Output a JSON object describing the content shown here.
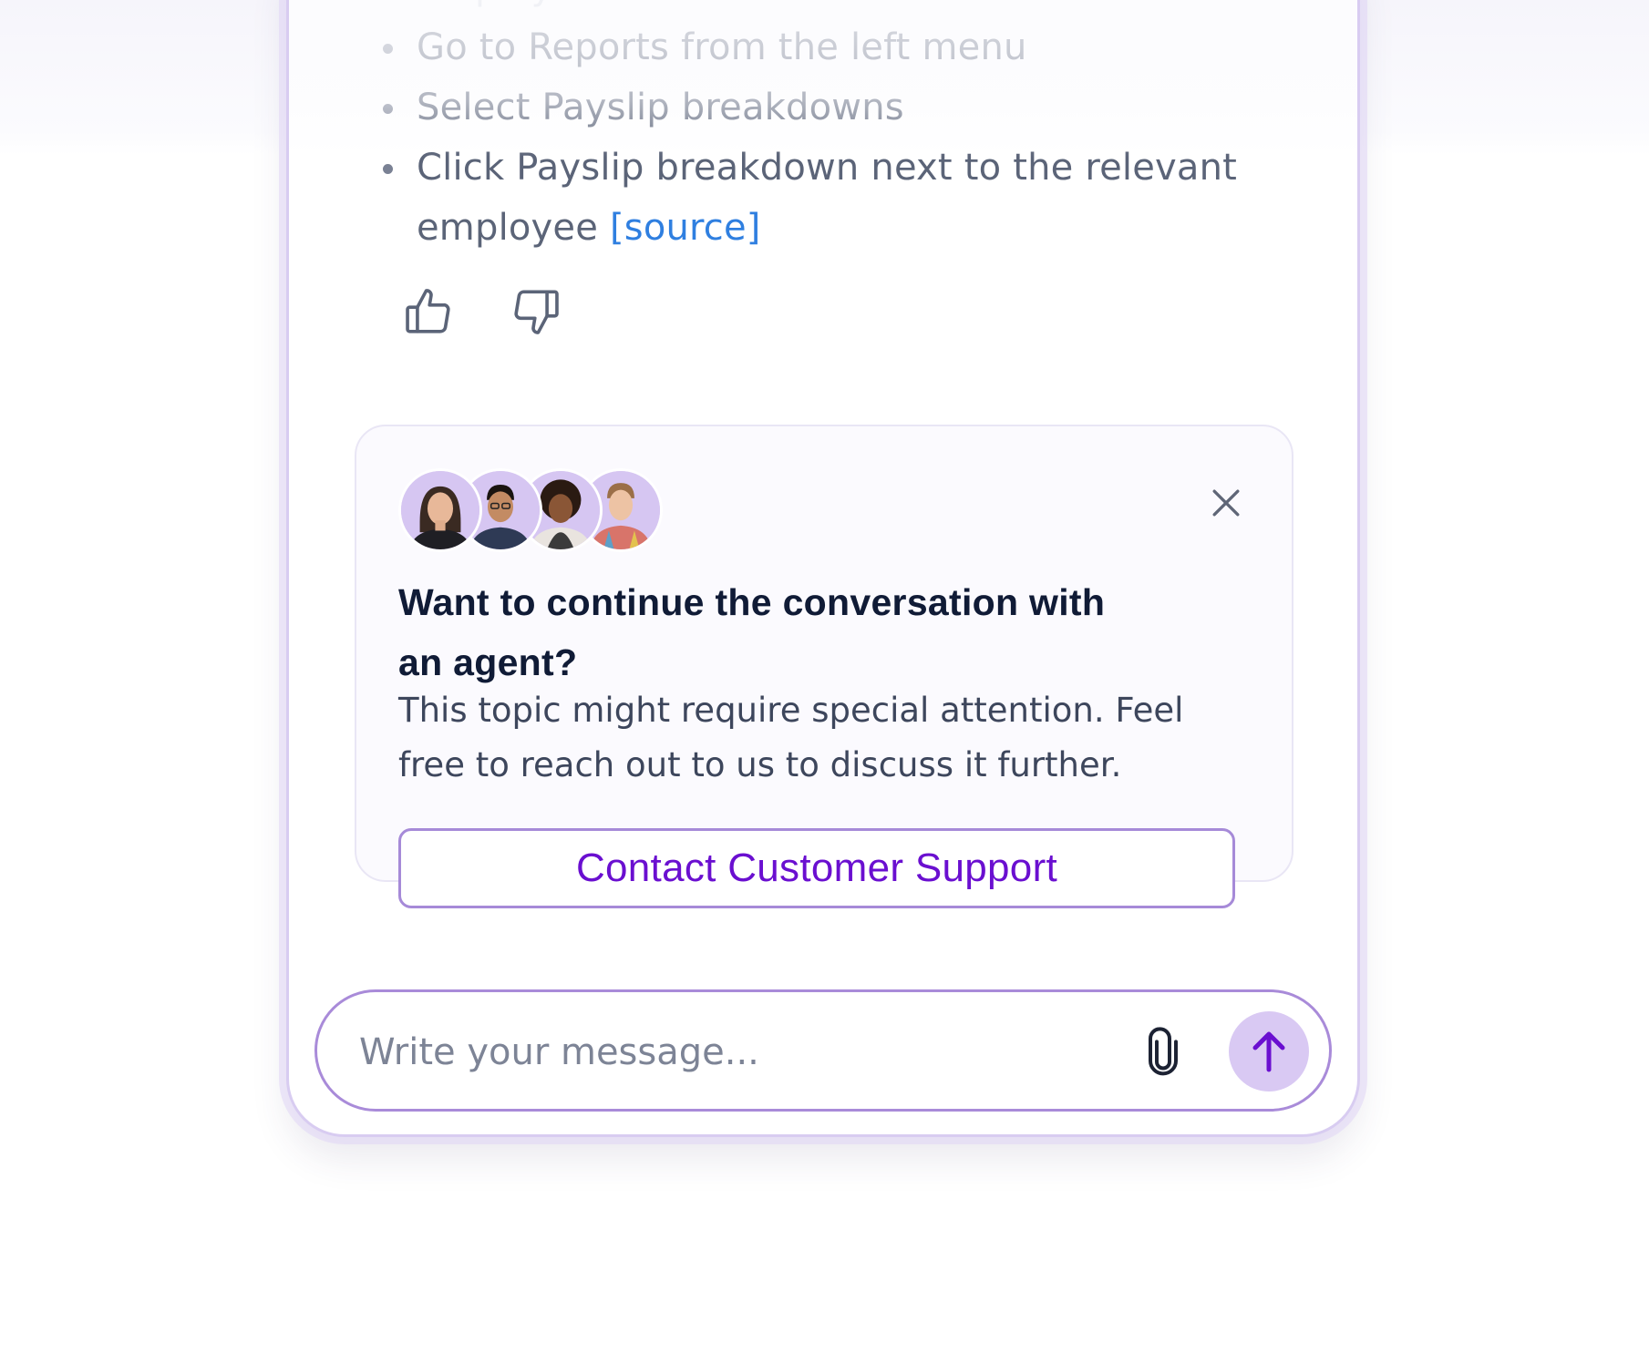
{
  "response": {
    "steps": [
      "employees.",
      "Go to Reports from the left menu",
      "Select Payslip breakdowns",
      "Click Payslip breakdown next to the relevant employee"
    ],
    "source_label": "[source]"
  },
  "feedback": {
    "like_icon": "thumbs-up-icon",
    "dislike_icon": "thumbs-down-icon"
  },
  "escalation": {
    "title": "Want to continue the conversation with an agent?",
    "body": "This topic might require special attention. Feel free to reach out to us to discuss it further.",
    "button_label": "Contact Customer Support",
    "close_icon": "close-icon",
    "agent_count": 4
  },
  "composer": {
    "placeholder": "Write your message...",
    "attach_icon": "paperclip-icon",
    "send_icon": "arrow-up-icon"
  },
  "colors": {
    "accent": "#6a0fd0",
    "accent_light": "#d9c9f3",
    "border": "#a98bd9",
    "link": "#2f7fe0",
    "text_dark": "#101b36",
    "text_body": "#3d465c"
  }
}
